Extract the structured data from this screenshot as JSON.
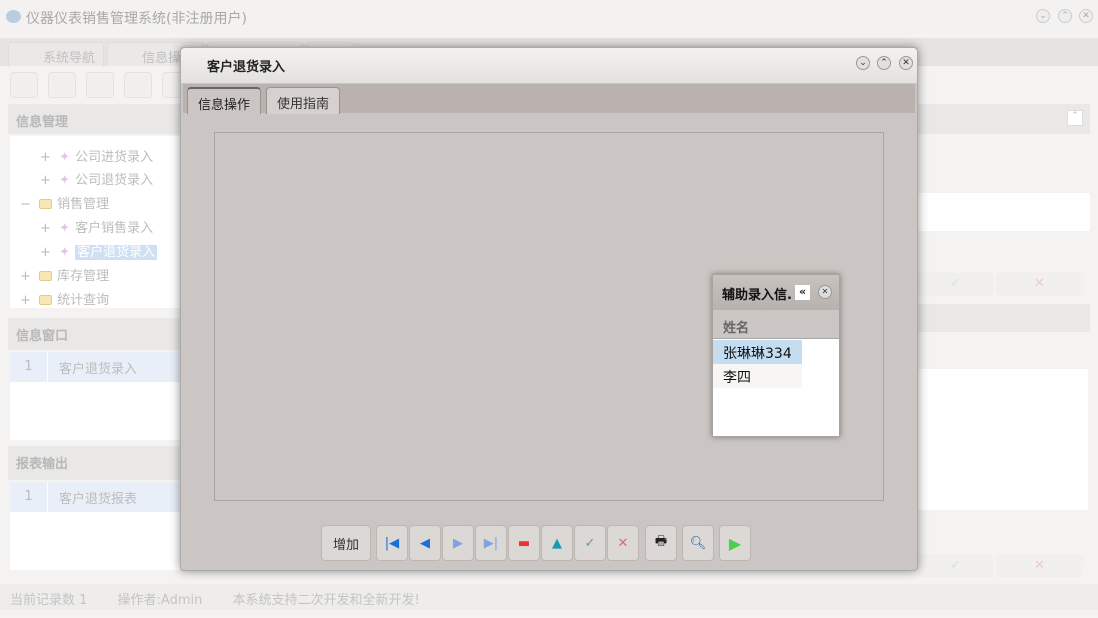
{
  "app": {
    "title": "仪器仪表销售管理系统(非注册用户)"
  },
  "main_tabs": [
    "系统导航",
    "信息操"
  ],
  "left": {
    "info_mgmt": "信息管理",
    "tree": [
      {
        "label": "公司进货录入",
        "level": 2,
        "icon": "wand"
      },
      {
        "label": "公司退货录入",
        "level": 2,
        "icon": "wand"
      },
      {
        "label": "销售管理",
        "level": 1,
        "icon": "folder",
        "expander": "−"
      },
      {
        "label": "客户销售录入",
        "level": 2,
        "icon": "wand"
      },
      {
        "label": "客户退货录入",
        "level": 2,
        "icon": "wand",
        "selected": true
      },
      {
        "label": "库存管理",
        "level": 1,
        "icon": "folder"
      },
      {
        "label": "统计查询",
        "level": 1,
        "icon": "folder"
      }
    ],
    "info_window": {
      "title": "信息窗口",
      "rows": [
        {
          "n": "1",
          "t": "客户退货录入"
        }
      ]
    },
    "report": {
      "title": "报表输出",
      "rows": [
        {
          "n": "1",
          "t": "客户退货报表"
        }
      ]
    }
  },
  "status": {
    "records": "当前记录数 1",
    "operator": "操作者:Admin",
    "note": "本系统支持二次开发和全新开发!"
  },
  "dialog": {
    "title": "客户退货录入",
    "tabs": [
      "信息操作",
      "使用指南"
    ],
    "add_label": "增加"
  },
  "popup": {
    "title": "辅助录入信.",
    "column": "姓名",
    "rows": [
      "张琳琳334",
      "李四"
    ]
  }
}
